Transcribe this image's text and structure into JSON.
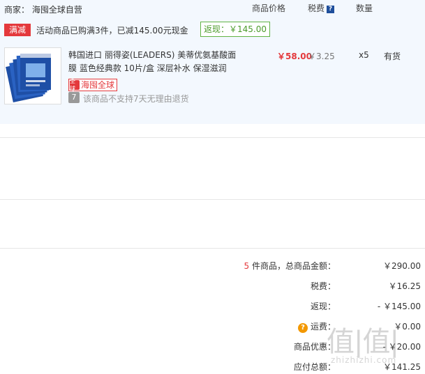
{
  "header": {
    "seller_label": "商家：",
    "seller_name": "海囤全球自营",
    "col_price": "商品价格",
    "col_tax": "税费",
    "col_tax_help": "?",
    "col_qty": "数量"
  },
  "promo": {
    "tag": "满减",
    "text": "活动商品已购满3件，已减145.00元现金",
    "rebate": "返现：￥145.00"
  },
  "item": {
    "title_line1": "韩国进口 丽得姿(LEADERS) 美蒂优氨基酸面",
    "title_line2": "膜 蓝色经典款 10片/盒 深层补水 保湿滋润",
    "badge": "海囤全球",
    "badge_logo": "全球",
    "no_return_icon": "7",
    "no_return_text": "该商品不支持7天无理由退货",
    "price": "￥58.00",
    "tax": "￥3.25",
    "qty": "x5",
    "stock": "有货"
  },
  "summary": {
    "count": "5",
    "count_suffix": "件商品，总商品金额：",
    "total": "￥290.00",
    "tax_label": "税费：",
    "tax": "￥16.25",
    "rebate_label": "返现：",
    "rebate": "- ￥145.00",
    "shipping_icon": "?",
    "shipping_label": "运费：",
    "shipping": "￥0.00",
    "discount_label": "商品优惠：",
    "discount": "- ￥20.00",
    "payable_label": "应付总额：",
    "payable": "￥141.25"
  },
  "watermark": {
    "big": "值|值|",
    "small": "zhizhizhi.com"
  },
  "colors": {
    "accent_red": "#e4393c",
    "rebate_green": "#4b9a2a",
    "panel_bg": "#f3f8fe"
  }
}
